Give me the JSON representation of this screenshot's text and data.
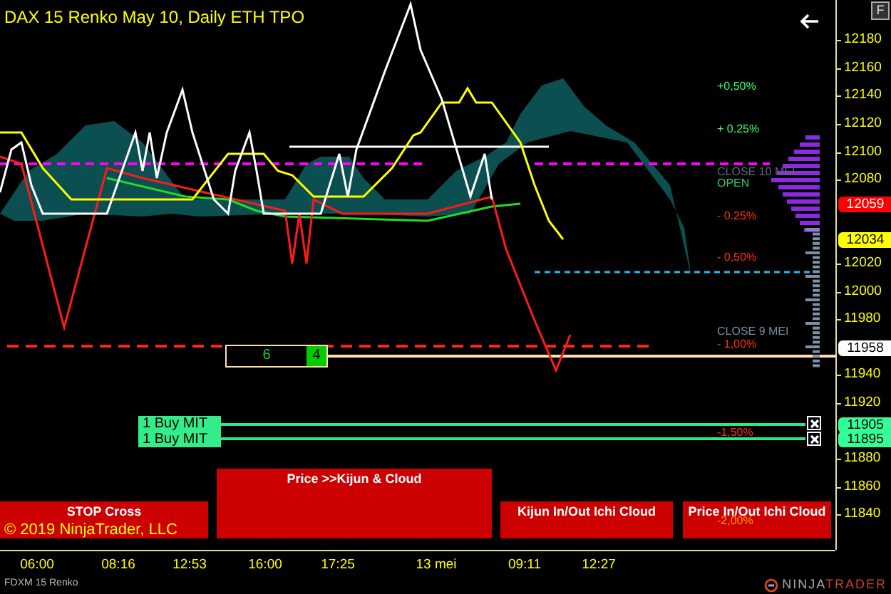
{
  "title": "DAX 15 Renko May 10, Daily ETH TPO",
  "price_axis": {
    "ticks": [
      "12180",
      "12160",
      "12140",
      "12120",
      "12100",
      "12080",
      "12020",
      "12000",
      "11980",
      "11940",
      "11920",
      "11880",
      "11860",
      "11840"
    ]
  },
  "time_axis": {
    "labels": [
      "06:00",
      "08:16",
      "12:53",
      "16:00",
      "17:25",
      "13 mei",
      "09:11",
      "12:27"
    ]
  },
  "level_labels": [
    {
      "text": "+0,50%",
      "color": "#33ff66"
    },
    {
      "text": "+ 0.25%",
      "color": "#33ff66"
    },
    {
      "text": "CLOSE 10 MEI",
      "color": "#5a6a7a"
    },
    {
      "text": "OPEN",
      "color": "#33cc66"
    },
    {
      "text": "- 0.25%",
      "color": "#ff3300"
    },
    {
      "text": "- 0,50%",
      "color": "#ff3300"
    },
    {
      "text": "CLOSE 9 MEI",
      "color": "#7a8a9a"
    },
    {
      "text": "- 1,00%",
      "color": "#ff3300"
    },
    {
      "text": "-1,50%",
      "color": "#ff3300"
    },
    {
      "text": "-2,00%",
      "color": "#ff9900"
    }
  ],
  "price_tags": [
    {
      "text": "12059",
      "color": "#ff0000"
    },
    {
      "text": "12034",
      "color": "#ffff00"
    },
    {
      "text": "11958",
      "color": "#ffffff"
    },
    {
      "text": "11905",
      "color": "#33ff99"
    },
    {
      "text": "11895",
      "color": "#33ff99"
    }
  ],
  "orders": [
    {
      "label": "1 Buy MIT"
    },
    {
      "label": "1 Buy MIT"
    }
  ],
  "position": {
    "quantity": "6",
    "filled": "4"
  },
  "signals": [
    "STOP Cross",
    "Price >>Kijun & Cloud",
    "Kijun In/Out Ichi Cloud",
    "Price In/Out Ichi Cloud"
  ],
  "copyright": "© 2019 NinjaTrader, LLC",
  "instrument": "FDXM 15 Renko",
  "logo": [
    "NINJA",
    "TRADER"
  ],
  "toolbar": {
    "button": "F"
  }
}
